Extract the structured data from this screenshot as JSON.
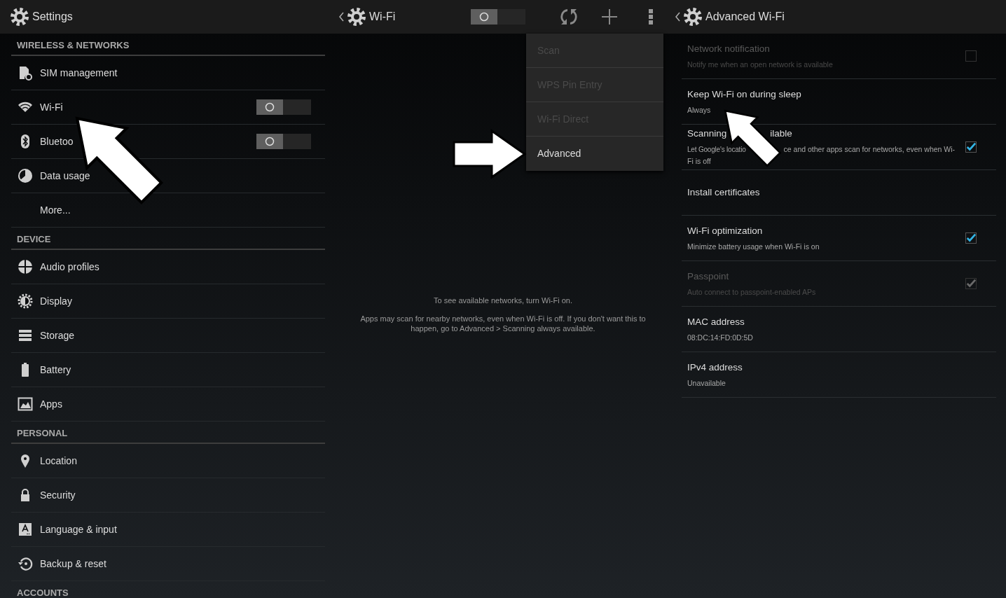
{
  "settings": {
    "title": "Settings",
    "sections": [
      {
        "header": "WIRELESS & NETWORKS",
        "items": [
          {
            "kind": "icon",
            "label": "SIM management"
          },
          {
            "kind": "toggle",
            "label": "Wi-Fi",
            "on": false
          },
          {
            "kind": "toggle",
            "label": "Bluetoo",
            "on": false
          },
          {
            "kind": "icon",
            "label": "Data usage"
          },
          {
            "kind": "plain",
            "label": "More..."
          }
        ]
      },
      {
        "header": "DEVICE",
        "items": [
          {
            "kind": "icon",
            "label": "Audio profiles"
          },
          {
            "kind": "icon",
            "label": "Display"
          },
          {
            "kind": "icon",
            "label": "Storage"
          },
          {
            "kind": "icon",
            "label": "Battery"
          },
          {
            "kind": "icon",
            "label": "Apps"
          }
        ]
      },
      {
        "header": "PERSONAL",
        "items": [
          {
            "kind": "icon",
            "label": "Location"
          },
          {
            "kind": "icon",
            "label": "Security"
          },
          {
            "kind": "icon",
            "label": "Language & input"
          },
          {
            "kind": "icon",
            "label": "Backup & reset"
          }
        ]
      },
      {
        "header": "ACCOUNTS"
      }
    ]
  },
  "wifi": {
    "title": "Wi-Fi",
    "switch_on": false,
    "menu": [
      {
        "label": "Scan",
        "disabled": true
      },
      {
        "label": "WPS Pin Entry",
        "disabled": true
      },
      {
        "label": "Wi-Fi Direct",
        "disabled": true
      },
      {
        "label": "Advanced",
        "disabled": false
      }
    ],
    "messages": [
      "To see available networks, turn Wi-Fi on.",
      "Apps may scan for nearby networks, even when Wi-Fi is off. If you don't want this to happen, go to Advanced > Scanning always available."
    ]
  },
  "advanced": {
    "title": "Advanced Wi-Fi",
    "items": [
      {
        "kind": "check",
        "title": "Network notification",
        "summary": "Notify me when an open network is available",
        "disabled": true,
        "checked": false
      },
      {
        "kind": "plain",
        "title": "Keep Wi-Fi on during sleep",
        "summary": "Always",
        "disabled": false
      },
      {
        "kind": "check",
        "title_parts": [
          "Scanning",
          "ilable"
        ],
        "summary_parts": [
          "Let Google's locatio",
          "ce and other apps scan for networks, even when Wi-",
          "Fi is off"
        ],
        "disabled": false,
        "checked": true
      },
      {
        "kind": "plain",
        "title": "Install certificates",
        "disabled": false
      },
      {
        "kind": "check",
        "title": "Wi-Fi optimization",
        "summary": "Minimize battery usage when Wi-Fi is on",
        "disabled": false,
        "checked": true
      },
      {
        "kind": "check",
        "title": "Passpoint",
        "summary": "Auto connect to passpoint-enabled APs",
        "disabled": true,
        "checked": true
      },
      {
        "kind": "plain",
        "title": "MAC address",
        "summary": "08:DC:14:FD:0D:5D",
        "disabled": false
      },
      {
        "kind": "plain",
        "title": "IPv4 address",
        "summary": "Unavailable",
        "disabled": false
      }
    ]
  }
}
